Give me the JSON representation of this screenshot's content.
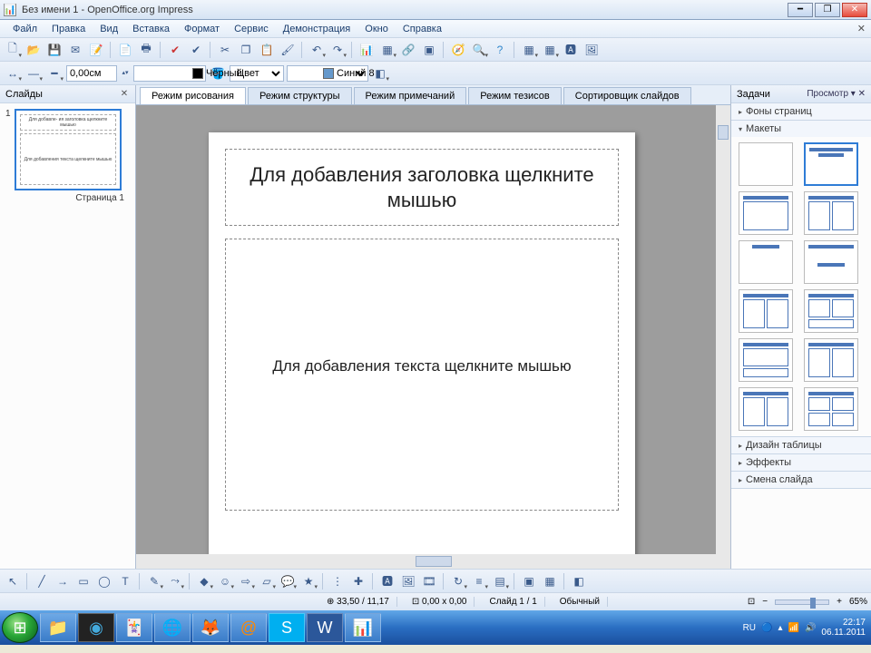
{
  "window": {
    "title": "Без имени 1 - OpenOffice.org Impress"
  },
  "menubar": [
    "Файл",
    "Правка",
    "Вид",
    "Вставка",
    "Формат",
    "Сервис",
    "Демонстрация",
    "Окно",
    "Справка"
  ],
  "line_toolbar": {
    "width_value": "0,00см",
    "color1_label": "Чёрный",
    "color1_hex": "#000000",
    "fill_type_label": "Цвет",
    "color2_label": "Синий 8",
    "color2_hex": "#6699cc"
  },
  "view_tabs": [
    "Режим рисования",
    "Режим структуры",
    "Режим примечаний",
    "Режим тезисов",
    "Сортировщик слайдов"
  ],
  "active_view_tab": 0,
  "slides_panel": {
    "title": "Слайды",
    "page_label": "Страница 1",
    "thumb_title": "Для добавле- ия заголовка щелкните мышью",
    "thumb_content": "Для добавления текста щелкните мышью"
  },
  "slide": {
    "title_placeholder": "Для добавления заголовка щелкните мышью",
    "content_placeholder": "Для добавления текста щелкните мышью"
  },
  "tasks_panel": {
    "title": "Задачи",
    "view_label": "Просмотр",
    "sections": {
      "backgrounds": "Фоны страниц",
      "layouts": "Макеты",
      "table_design": "Дизайн таблицы",
      "effects": "Эффекты",
      "transition": "Смена слайда"
    }
  },
  "statusbar": {
    "coords": "33,50 / 11,17",
    "size": "0,00 x 0,00",
    "slide": "Слайд 1 / 1",
    "style": "Обычный",
    "zoom": "65%"
  },
  "taskbar": {
    "lang": "RU",
    "time": "22:17",
    "date": "06.11.2011"
  }
}
